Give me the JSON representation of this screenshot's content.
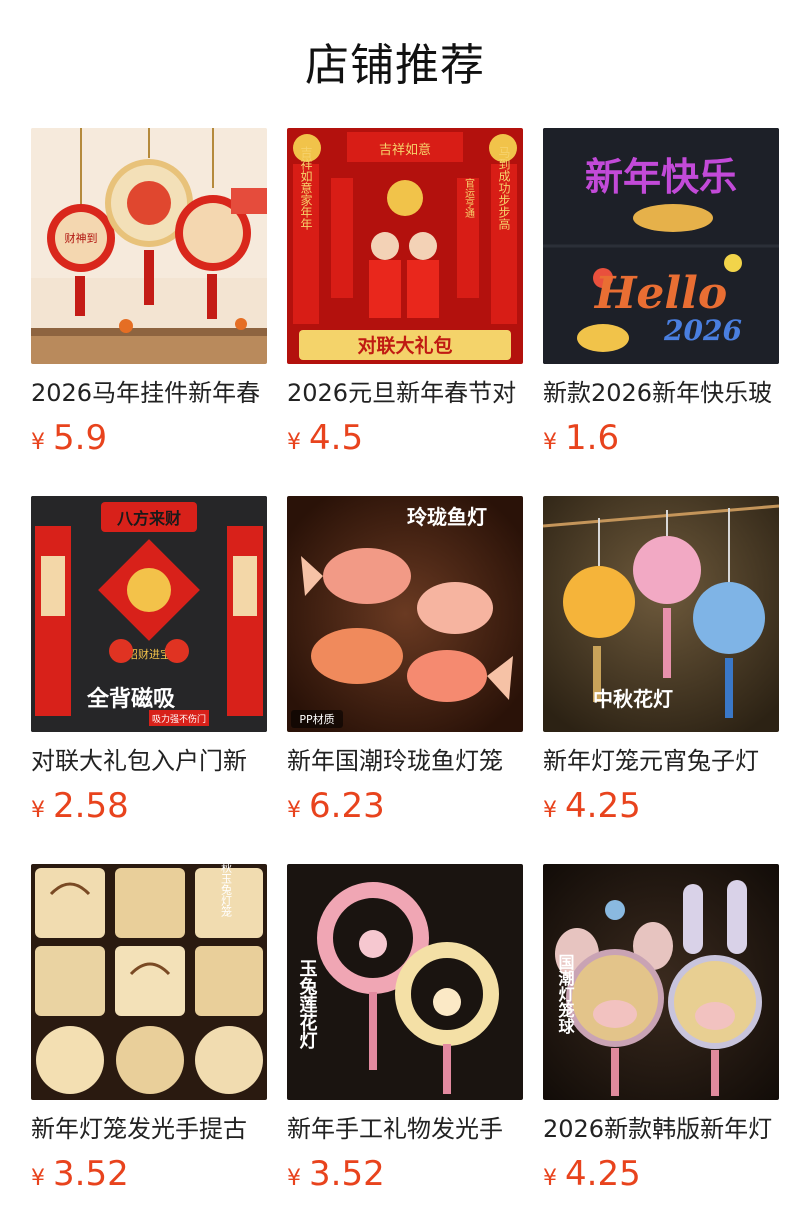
{
  "page_title": "店铺推荐",
  "currency_symbol": "¥",
  "accent_color": "#e8431d",
  "products": [
    {
      "title": "2026马年挂件新年春",
      "price": "5.9",
      "image_subject": "lantern-wall-hanging",
      "image_texts": {
        "hang": "财神到"
      }
    },
    {
      "title": "2026元旦新年春节对",
      "price": "4.5",
      "image_subject": "couplet-gift-set",
      "image_texts": {
        "banner": "对联大礼包",
        "left_couplet": "吉祥如意家年年",
        "right_couplet": "马到成功步步高",
        "head": "吉祥如意",
        "sub": "官运亨通"
      }
    },
    {
      "title": "新款2026新年快乐玻",
      "price": "1.6",
      "image_subject": "window-sticker",
      "image_texts": {
        "top": "新年快乐",
        "hello": "Hello",
        "year": "2026"
      }
    },
    {
      "title": "对联大礼包入户门新",
      "price": "2.58",
      "image_subject": "magnetic-couplet",
      "image_texts": {
        "top": "八方来财",
        "center": "招财进宝",
        "bottom": "全背磁吸",
        "sub": "吸力强不伤门"
      }
    },
    {
      "title": "新年国潮玲珑鱼灯笼",
      "price": "6.23",
      "image_subject": "fish-lanterns",
      "image_texts": {
        "top": "玲珑鱼灯",
        "badge": "PP材质"
      }
    },
    {
      "title": "新年灯笼元宵兔子灯",
      "price": "4.25",
      "image_subject": "flower-ball-lanterns",
      "image_texts": {
        "caption": "中秋花灯"
      }
    },
    {
      "title": "新年灯笼发光手提古",
      "price": "3.52",
      "image_subject": "paper-lantern-grid",
      "image_texts": {
        "side": "中秋玉兔灯笼"
      }
    },
    {
      "title": "新年手工礼物发光手",
      "price": "3.52",
      "image_subject": "wreath-lanterns",
      "image_texts": {
        "side": "玉兔莲花灯"
      }
    },
    {
      "title": "2026新款韩版新年灯",
      "price": "4.25",
      "image_subject": "bunny-ear-lanterns",
      "image_texts": {
        "side": "国潮灯笼球"
      }
    }
  ]
}
